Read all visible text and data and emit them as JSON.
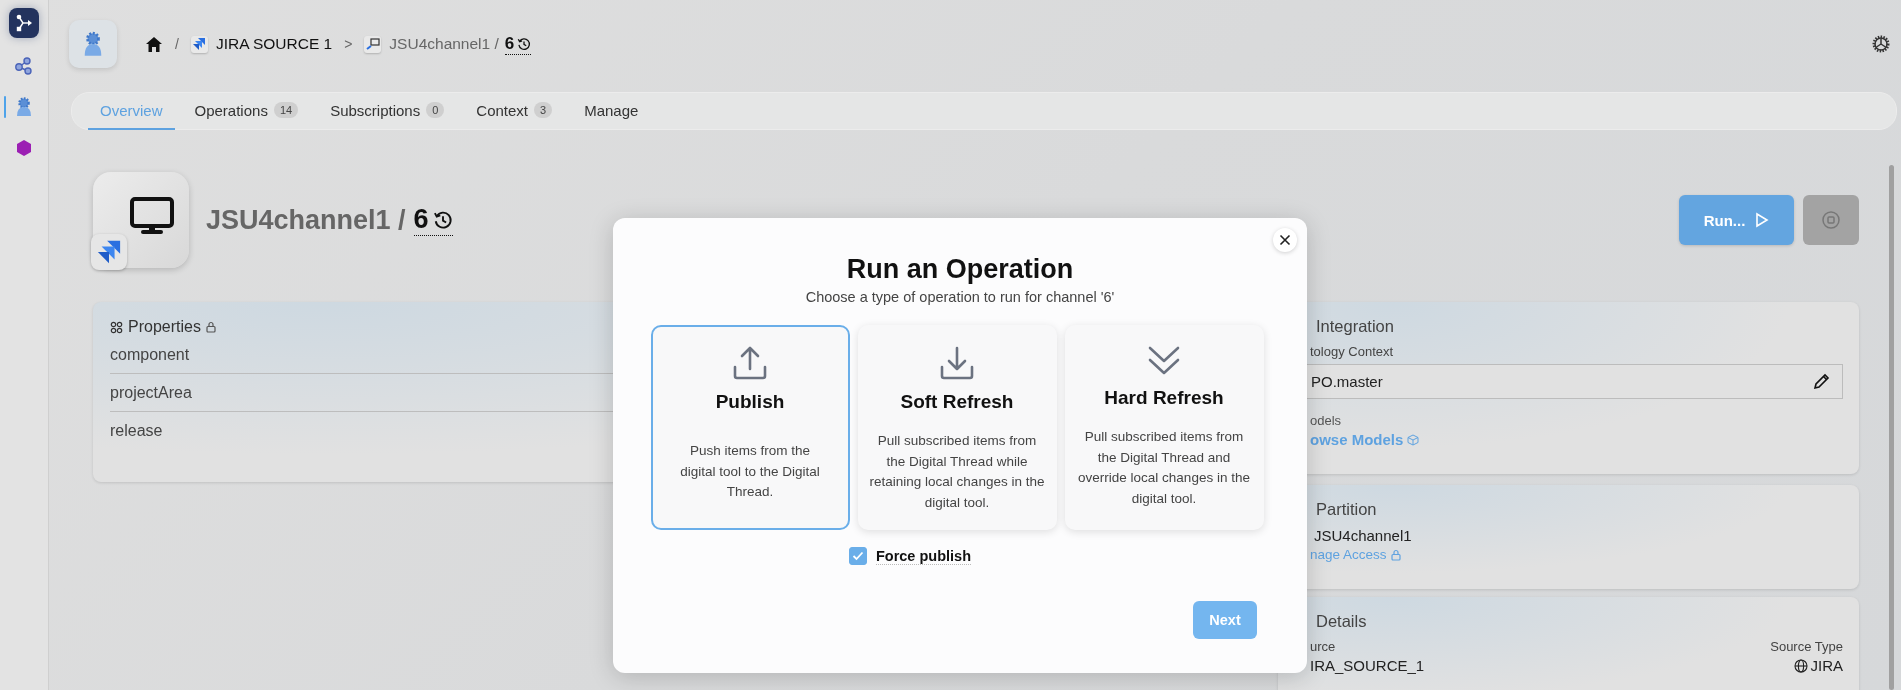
{
  "sidebar": {
    "items": [
      {
        "kind": "logo",
        "selected": false
      },
      {
        "kind": "graph",
        "selected": false
      },
      {
        "kind": "gear",
        "selected": true
      },
      {
        "kind": "cube",
        "selected": false
      }
    ]
  },
  "breadcrumb": [
    {
      "kind": "home",
      "separator": "/"
    },
    {
      "kind": "source",
      "label": "JIRA SOURCE 1",
      "separator": ">"
    },
    {
      "kind": "channel",
      "label": "JSU4channel1 /",
      "version": "6"
    }
  ],
  "tabs": [
    {
      "label": "Overview",
      "selected": true
    },
    {
      "label": "Operations",
      "count": "14",
      "selected": false
    },
    {
      "label": "Subscriptions",
      "count": "0",
      "selected": false
    },
    {
      "label": "Context",
      "count": "3",
      "selected": false
    },
    {
      "label": "Manage",
      "selected": false
    }
  ],
  "header": {
    "title": "JSU4channel1 /",
    "version": "6",
    "run_button": "Run..."
  },
  "properties": {
    "title": "Properties",
    "rows": [
      "component",
      "projectArea",
      "release"
    ]
  },
  "integration": {
    "title": "Integration",
    "context_label": "tology Context",
    "context_value": "PO.master",
    "models_label": "odels",
    "models_link": "owse Models"
  },
  "partition": {
    "title": "Partition",
    "name": "JSU4channel1",
    "link": "nage Access"
  },
  "details": {
    "title": "Details",
    "source_label": "urce",
    "source_value": "IRA_SOURCE_1",
    "source_type_label": "Source Type",
    "source_type_value": "JIRA"
  },
  "modal": {
    "title": "Run an Operation",
    "subtitle": "Choose a type of operation to run for channel '6'",
    "options": [
      {
        "kind": "upload",
        "title": "Publish",
        "description": "Push items from the digital tool to the Digital Thread.",
        "selected": true
      },
      {
        "kind": "download",
        "title": "Soft Refresh",
        "description": "Pull subscribed items from the Digital Thread while retaining local changes in the digital tool.",
        "selected": false
      },
      {
        "kind": "double",
        "title": "Hard Refresh",
        "description": "Pull subscribed items from the Digital Thread and override local changes in the digital tool.",
        "selected": false
      }
    ],
    "force": {
      "label": "Force publish",
      "checked": true
    },
    "next_button": "Next"
  }
}
